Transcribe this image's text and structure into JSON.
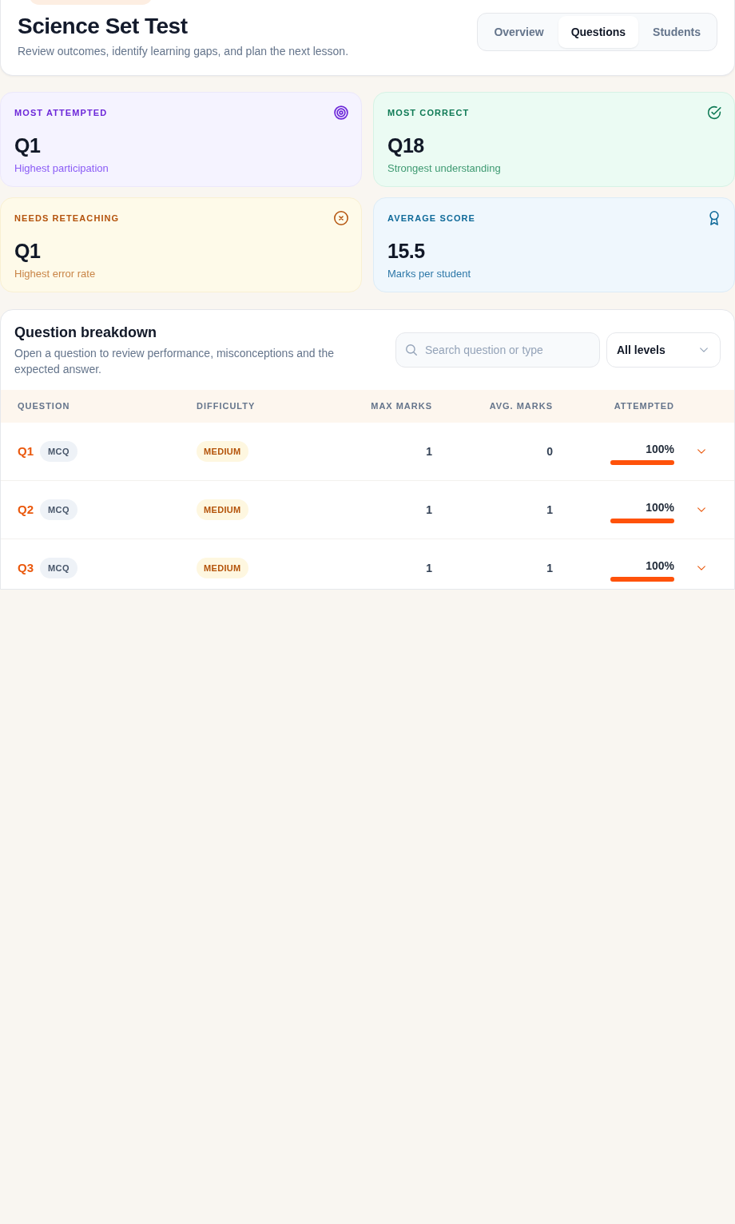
{
  "header": {
    "title": "Science Set Test",
    "subtitle": "Review outcomes, identify learning gaps, and plan the next lesson.",
    "tabs": [
      {
        "label": "Overview",
        "selected": false
      },
      {
        "label": "Questions",
        "selected": true
      },
      {
        "label": "Students",
        "selected": false
      }
    ]
  },
  "stats": [
    {
      "kind": "target",
      "color": "#6d28d9",
      "label": "MOST ATTEMPTED",
      "value": "Q1",
      "caption": "Highest participation"
    },
    {
      "kind": "check",
      "color": "#0f7a55",
      "label": "MOST CORRECT",
      "value": "Q18",
      "caption": "Strongest understanding"
    },
    {
      "kind": "cross",
      "color": "#b4530d",
      "label": "NEEDS RETEACHING",
      "value": "Q1",
      "caption": "Highest error rate"
    },
    {
      "kind": "award",
      "color": "#0f6a99",
      "label": "AVERAGE SCORE",
      "value": "15.5",
      "caption": "Marks per student"
    }
  ],
  "breakdown": {
    "title": "Question breakdown",
    "description": "Open a question to review performance, misconceptions and the expected answer.",
    "search": {
      "placeholder": "Search question or type"
    },
    "level_filter": {
      "value": "All levels"
    },
    "table": {
      "columns": [
        "QUESTION",
        "DIFFICULTY",
        "MAX MARKS",
        "AVG. MARKS",
        "ATTEMPTED"
      ],
      "rows": [
        {
          "question": "Q1",
          "type": "MCQ",
          "difficulty": "MEDIUM",
          "max_marks": "1",
          "avg_marks": "0",
          "attempted": "100%",
          "level": 1,
          "expanded": false
        },
        {
          "question": "Q2",
          "type": "MCQ",
          "difficulty": "MEDIUM",
          "max_marks": "1",
          "avg_marks": "1",
          "attempted": "100%",
          "level": 1,
          "expanded": false
        },
        {
          "question": "Q3",
          "type": "MCQ",
          "difficulty": "MEDIUM",
          "max_marks": "1",
          "avg_marks": "1",
          "attempted": "100%",
          "level": 1,
          "expanded": false
        }
      ]
    }
  }
}
